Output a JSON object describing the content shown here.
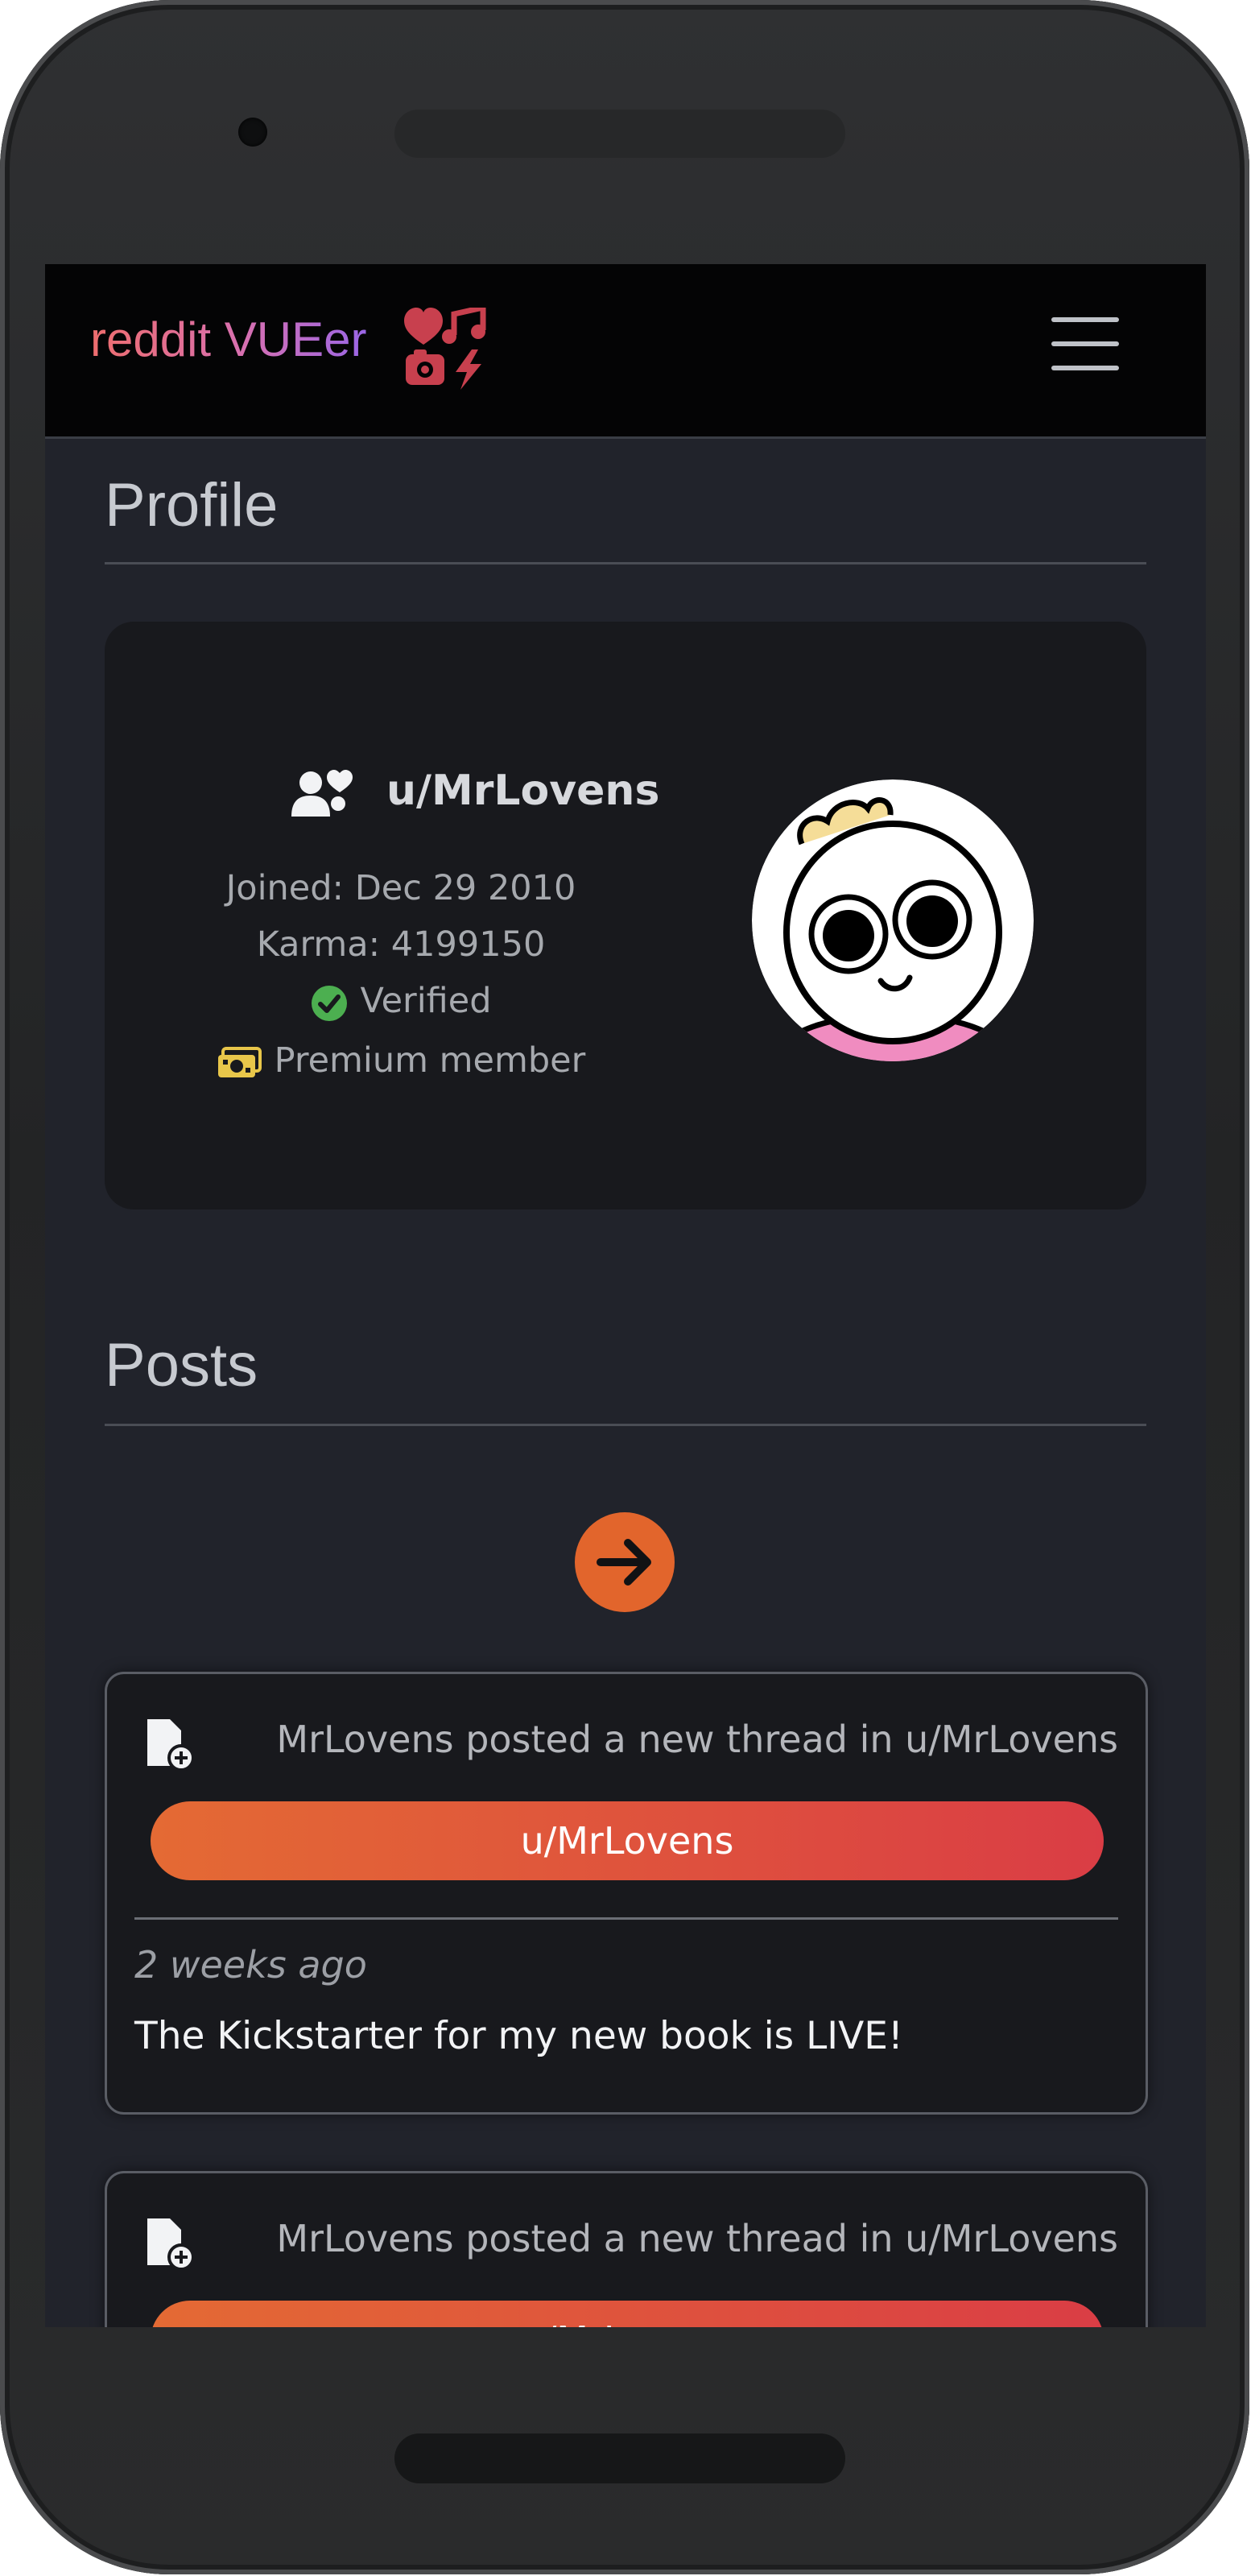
{
  "navbar": {
    "brand": "reddit VUEer",
    "logo_icon": "heart-music-camera-bolt-icon",
    "menu_icon": "hamburger-icon"
  },
  "profile": {
    "section_title": "Profile",
    "username": "u/MrLovens",
    "joined": "Joined: Dec 29 2010",
    "karma": "Karma: 4199150",
    "verified": "Verified",
    "premium": "Premium member",
    "user_icon": "user-heart-icon",
    "verified_icon": "check-circle-icon",
    "premium_icon": "money-bill-icon"
  },
  "posts": {
    "section_title": "Posts",
    "next_icon": "arrow-right-icon",
    "items": [
      {
        "header": "MrLovens posted a new thread in u/MrLovens",
        "subreddit": "u/MrLovens",
        "time": "2 weeks ago",
        "title": "The Kickstarter for my new book is LIVE!"
      },
      {
        "header": "MrLovens posted a new thread in u/MrLovens",
        "subreddit": "u/MrLovens"
      }
    ]
  },
  "colors": {
    "accent": "#e2652c",
    "pill_start": "#e46a34",
    "pill_end": "#da3d45",
    "verified": "#4caf50",
    "premium": "#e8c64a",
    "screen_bg": "#21232b",
    "card_bg": "#18191d"
  }
}
